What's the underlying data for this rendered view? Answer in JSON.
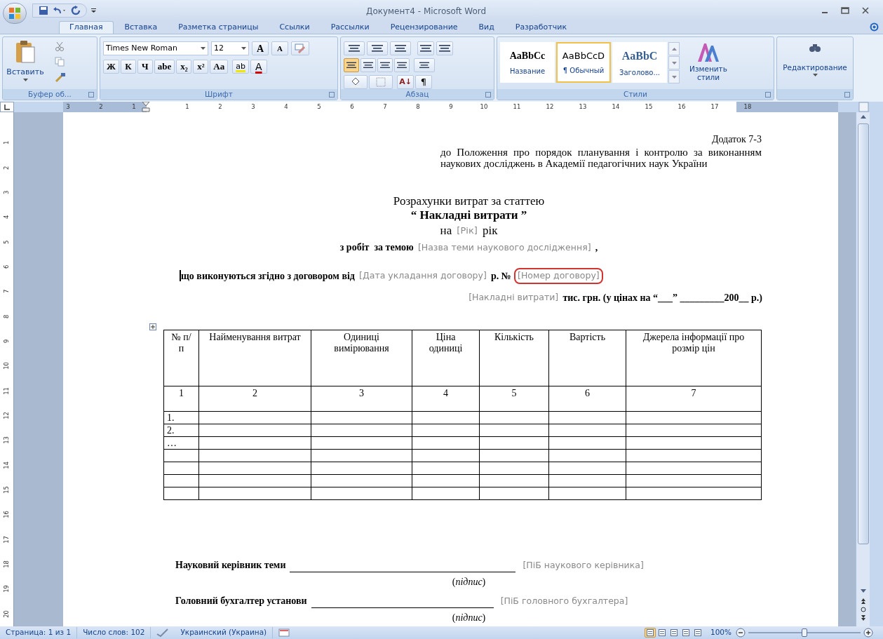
{
  "window": {
    "title": "Документ4 - Microsoft Word"
  },
  "tabs": [
    {
      "label": "Главная",
      "selected": true
    },
    {
      "label": "Вставка",
      "selected": false
    },
    {
      "label": "Разметка страницы",
      "selected": false
    },
    {
      "label": "Ссылки",
      "selected": false
    },
    {
      "label": "Рассылки",
      "selected": false
    },
    {
      "label": "Рецензирование",
      "selected": false
    },
    {
      "label": "Вид",
      "selected": false
    },
    {
      "label": "Разработчик",
      "selected": false
    }
  ],
  "ribbon": {
    "clipboard": {
      "paste": "Вставить",
      "group": "Буфер об..."
    },
    "font": {
      "name": "Times New Roman",
      "size": "12",
      "grow": "A",
      "shrink": "A",
      "format": [
        "Ж",
        "К",
        "Ч",
        "abe",
        "x₂",
        "x²",
        "Aa"
      ],
      "highlight": "ab",
      "font_color_letter": "A",
      "group": "Шрифт"
    },
    "paragraph": {
      "sort": "А↓",
      "marks": "¶",
      "group": "Абзац"
    },
    "styles": {
      "items": [
        {
          "sample": "AaBbCc",
          "label": "Название",
          "selected": false
        },
        {
          "sample": "AaBbCcD",
          "label": "¶ Обычный",
          "selected": true
        },
        {
          "sample": "AaBbC",
          "label": "Заголово...",
          "selected": false
        }
      ],
      "change": "Изменить стили",
      "group": "Стили"
    },
    "editing": {
      "label": "Редактирование"
    }
  },
  "ruler": {
    "horizontal": [
      "3",
      "2",
      "1",
      "1",
      "2",
      "3",
      "4",
      "5",
      "6",
      "7",
      "8",
      "9",
      "10",
      "11",
      "12",
      "13",
      "14",
      "15",
      "16",
      "17",
      "18"
    ],
    "vertical": [
      "1",
      "2",
      "3",
      "4",
      "5",
      "6",
      "7",
      "8",
      "9",
      "10",
      "11",
      "12",
      "13",
      "14",
      "15",
      "16",
      "17",
      "18",
      "19",
      "20"
    ]
  },
  "document": {
    "appendix": {
      "title": "Додаток 7-3",
      "text": "до Положення про порядок планування і контролю за виконанням наукових досліджень в Академії педагогічних наук України"
    },
    "heading": {
      "title": "Розрахунки витрат за статтею",
      "subtitle": "“ Накладні витрати ”"
    },
    "year_line": [
      {
        "kind": "text",
        "text": "на"
      },
      {
        "kind": "field",
        "text": "[Рік]",
        "highlighted": false
      },
      {
        "kind": "text",
        "text": "рік"
      }
    ],
    "topic_line": [
      {
        "kind": "bold",
        "text": "з робіт  за темою"
      },
      {
        "kind": "field",
        "text": "[Назва теми наукового дослідження]",
        "highlighted": false
      },
      {
        "kind": "bold",
        "text": ","
      }
    ],
    "contract_line": [
      {
        "kind": "bold",
        "text": "що виконуються згідно з договором від"
      },
      {
        "kind": "field",
        "text": "[Дата укладання договору]",
        "highlighted": false
      },
      {
        "kind": "bold",
        "text": "р. №"
      },
      {
        "kind": "field",
        "text": "[Номер договору]",
        "highlighted": true
      }
    ],
    "cost_line": [
      {
        "kind": "field",
        "text": "[Накладні витрати]",
        "highlighted": false
      },
      {
        "kind": "bold",
        "text": "тис. грн. (у цінах на “___” _________200__ р.)"
      }
    ],
    "table": {
      "columns": [
        "№ п/п",
        "Найменування витрат",
        "Одиниці вимірювання",
        "Ціна одиниці",
        "Кількість",
        "Вартість",
        "Джерела інформації про розмір цін"
      ],
      "numbers": [
        "1",
        "2",
        "3",
        "4",
        "5",
        "6",
        "7"
      ],
      "rows": [
        {
          "no": "1."
        },
        {
          "no": "2."
        },
        {
          "no": "…"
        },
        {},
        {},
        {},
        {}
      ]
    },
    "signatures": [
      {
        "label": "Науковий керівник теми",
        "field": "[ПіБ наукового керівника]",
        "note": "(*підпис*)"
      },
      {
        "label": "Головний бухгалтер установи",
        "field": "[ПіБ головного бухгалтера]",
        "note": "(*підпис*)"
      }
    ]
  },
  "status_bar": {
    "page": "Страница: 1 из 1",
    "words": "Число слов: 102",
    "language": "Украинский (Украина)",
    "views": [
      {
        "selected": true
      },
      {
        "selected": false
      },
      {
        "selected": false
      },
      {
        "selected": false
      },
      {
        "selected": false
      }
    ],
    "zoom": "100%",
    "zoom_slider": {
      "level": 0.5
    }
  }
}
